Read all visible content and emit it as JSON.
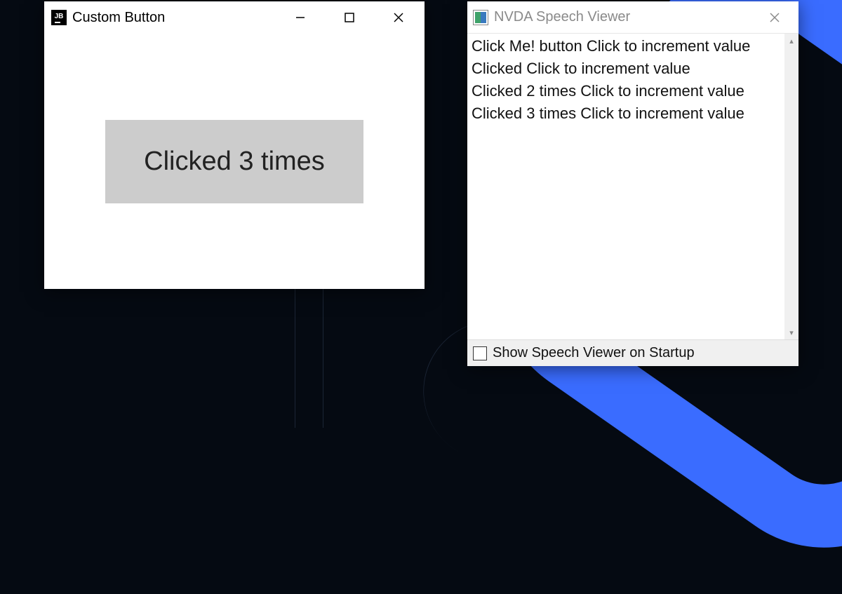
{
  "window1": {
    "app_icon": "JB",
    "title": "Custom Button",
    "button_text": "Clicked 3 times"
  },
  "window2": {
    "title": "NVDA Speech Viewer",
    "log_lines": [
      "Click Me!  button  Click to increment value",
      "Clicked Click to increment value",
      "Clicked 2 times Click to increment value",
      "Clicked 3 times Click to increment value"
    ],
    "checkbox_checked": false,
    "checkbox_label": "Show Speech Viewer on Startup"
  }
}
